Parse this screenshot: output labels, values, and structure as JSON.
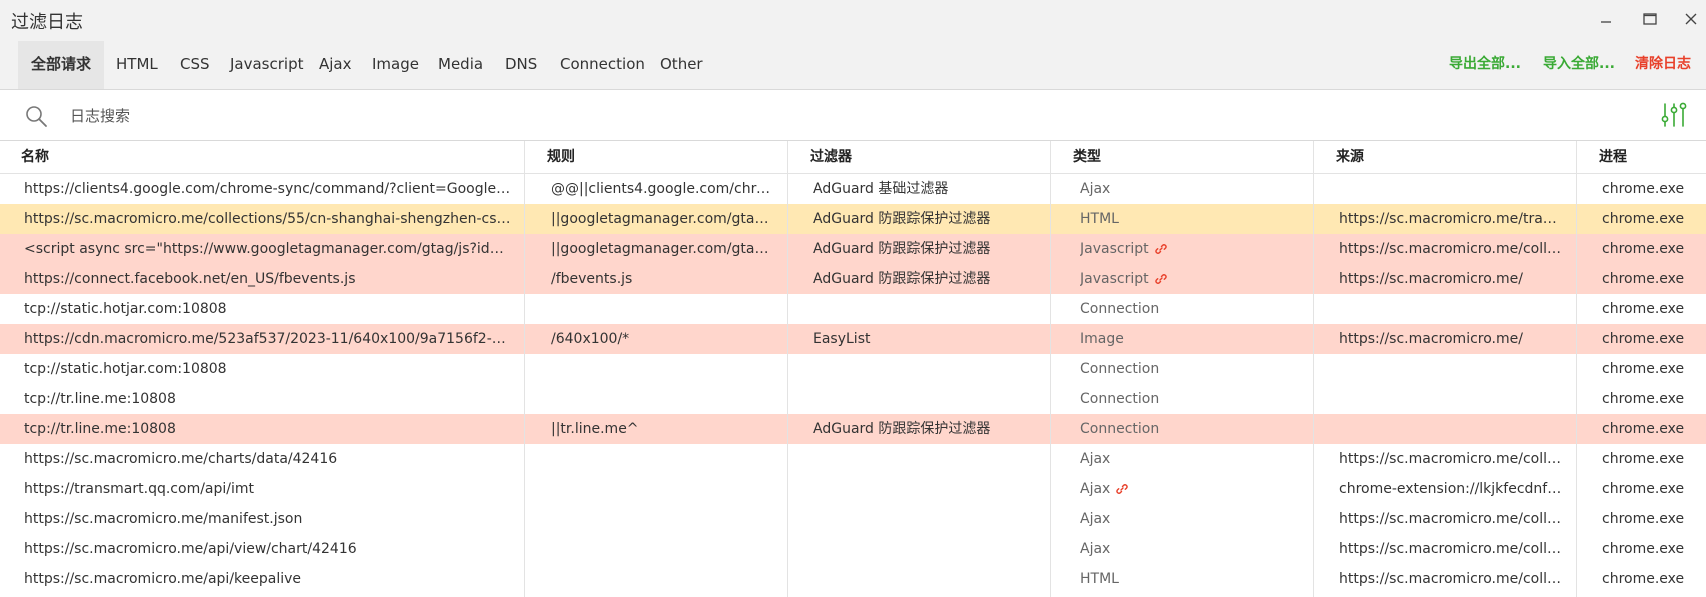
{
  "window": {
    "title": "过滤日志",
    "minimize_glyph": "—",
    "maximize_glyph": "☐",
    "close_glyph": "✕"
  },
  "tabs": [
    "全部请求",
    "HTML",
    "CSS",
    "Javascript",
    "Ajax",
    "Image",
    "Media",
    "DNS",
    "Connection",
    "Other"
  ],
  "actions": {
    "export": "导出全部...",
    "import": "导入全部...",
    "clear": "清除日志"
  },
  "search": {
    "placeholder": "日志搜索",
    "value": ""
  },
  "colors": {
    "green": "#3aaa35",
    "red": "#e8402a",
    "row_blocked": "#ffd6cc",
    "row_modified": "#ffe8b3",
    "row_default": "#ffffff"
  },
  "columns": [
    "名称",
    "规则",
    "过滤器",
    "类型",
    "来源",
    "进程"
  ],
  "rows": [
    {
      "status": "default",
      "name": "https://clients4.google.com/chrome-sync/command/?client=Google+C...",
      "rule": "@@||clients4.google.com/chro...",
      "filter": "AdGuard 基础过滤器",
      "type": "Ajax",
      "link": false,
      "source": "",
      "process": "chrome.exe"
    },
    {
      "status": "modified",
      "name": "https://sc.macromicro.me/collections/55/cn-shanghai-shengzhen-csi-30...",
      "rule": "||googletagmanager.com/gtag/...",
      "filter": "AdGuard 防跟踪保护过滤器",
      "type": "HTML",
      "link": false,
      "source": "https://sc.macromicro.me/trade...",
      "process": "chrome.exe"
    },
    {
      "status": "blocked",
      "name": "<script async src=\"https://www.googletagmanager.com/gtag/js?id=G-4...",
      "rule": "||googletagmanager.com/gtag/...",
      "filter": "AdGuard 防跟踪保护过滤器",
      "type": "Javascript",
      "link": true,
      "source": "https://sc.macromicro.me/collec...",
      "process": "chrome.exe"
    },
    {
      "status": "blocked",
      "name": "https://connect.facebook.net/en_US/fbevents.js",
      "rule": "/fbevents.js",
      "filter": "AdGuard 防跟踪保护过滤器",
      "type": "Javascript",
      "link": true,
      "source": "https://sc.macromicro.me/",
      "process": "chrome.exe"
    },
    {
      "status": "default",
      "name": "tcp://static.hotjar.com:10808",
      "rule": "",
      "filter": "",
      "type": "Connection",
      "link": false,
      "source": "",
      "process": "chrome.exe"
    },
    {
      "status": "blocked",
      "name": "https://cdn.macromicro.me/523af537/2023-11/640x100/9a7156f2-3939...",
      "rule": "/640x100/*",
      "filter": "EasyList",
      "type": "Image",
      "link": false,
      "source": "https://sc.macromicro.me/",
      "process": "chrome.exe"
    },
    {
      "status": "default",
      "name": "tcp://static.hotjar.com:10808",
      "rule": "",
      "filter": "",
      "type": "Connection",
      "link": false,
      "source": "",
      "process": "chrome.exe"
    },
    {
      "status": "default",
      "name": "tcp://tr.line.me:10808",
      "rule": "",
      "filter": "",
      "type": "Connection",
      "link": false,
      "source": "",
      "process": "chrome.exe"
    },
    {
      "status": "blocked",
      "name": "tcp://tr.line.me:10808",
      "rule": "||tr.line.me^",
      "filter": "AdGuard 防跟踪保护过滤器",
      "type": "Connection",
      "link": false,
      "source": "",
      "process": "chrome.exe"
    },
    {
      "status": "default",
      "name": "https://sc.macromicro.me/charts/data/42416",
      "rule": "",
      "filter": "",
      "type": "Ajax",
      "link": false,
      "source": "https://sc.macromicro.me/collec...",
      "process": "chrome.exe"
    },
    {
      "status": "default",
      "name": "https://transmart.qq.com/api/imt",
      "rule": "",
      "filter": "",
      "type": "Ajax",
      "link": true,
      "source": "chrome-extension://lkjkfecdnfjo...",
      "process": "chrome.exe"
    },
    {
      "status": "default",
      "name": "https://sc.macromicro.me/manifest.json",
      "rule": "",
      "filter": "",
      "type": "Ajax",
      "link": false,
      "source": "https://sc.macromicro.me/collec...",
      "process": "chrome.exe"
    },
    {
      "status": "default",
      "name": "https://sc.macromicro.me/api/view/chart/42416",
      "rule": "",
      "filter": "",
      "type": "Ajax",
      "link": false,
      "source": "https://sc.macromicro.me/collec...",
      "process": "chrome.exe"
    },
    {
      "status": "default",
      "name": "https://sc.macromicro.me/api/keepalive",
      "rule": "",
      "filter": "",
      "type": "HTML",
      "link": false,
      "source": "https://sc.macromicro.me/collec...",
      "process": "chrome.exe"
    }
  ]
}
